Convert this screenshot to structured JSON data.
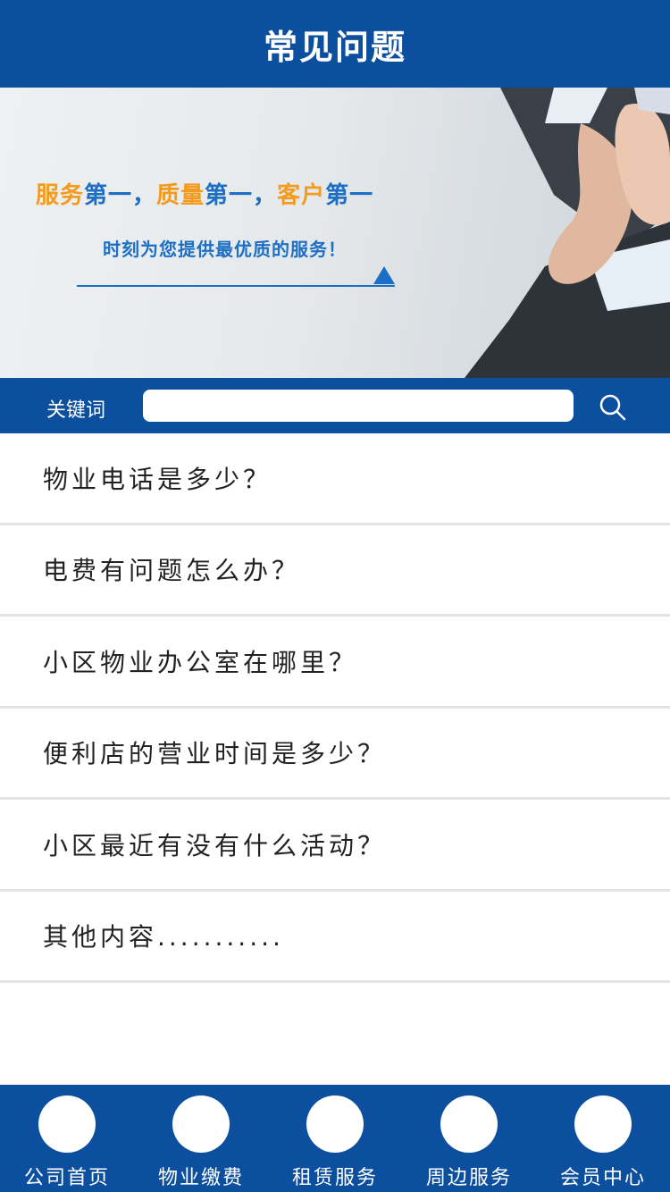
{
  "header": {
    "title": "常见问题"
  },
  "banner": {
    "slogan_parts": [
      "服务",
      "第一，",
      "质量",
      "第一，",
      "客户",
      "第一"
    ],
    "subtitle": "时刻为您提供最优质的服务！"
  },
  "search": {
    "label": "关键词",
    "value": "",
    "placeholder": ""
  },
  "faq": {
    "items": [
      "物业电话是多少？",
      "电费有问题怎么办？",
      "小区物业办公室在哪里？",
      "便利店的营业时间是多少？",
      "小区最近有没有什么活动？",
      "其他内容..........."
    ]
  },
  "tabbar": {
    "items": [
      {
        "label": "公司首页"
      },
      {
        "label": "物业缴费"
      },
      {
        "label": "租赁服务"
      },
      {
        "label": "周边服务"
      },
      {
        "label": "会员中心"
      }
    ]
  },
  "colors": {
    "primary": "#0b4f9e",
    "accent_orange": "#f39b1e",
    "accent_blue": "#1d6fc4"
  }
}
